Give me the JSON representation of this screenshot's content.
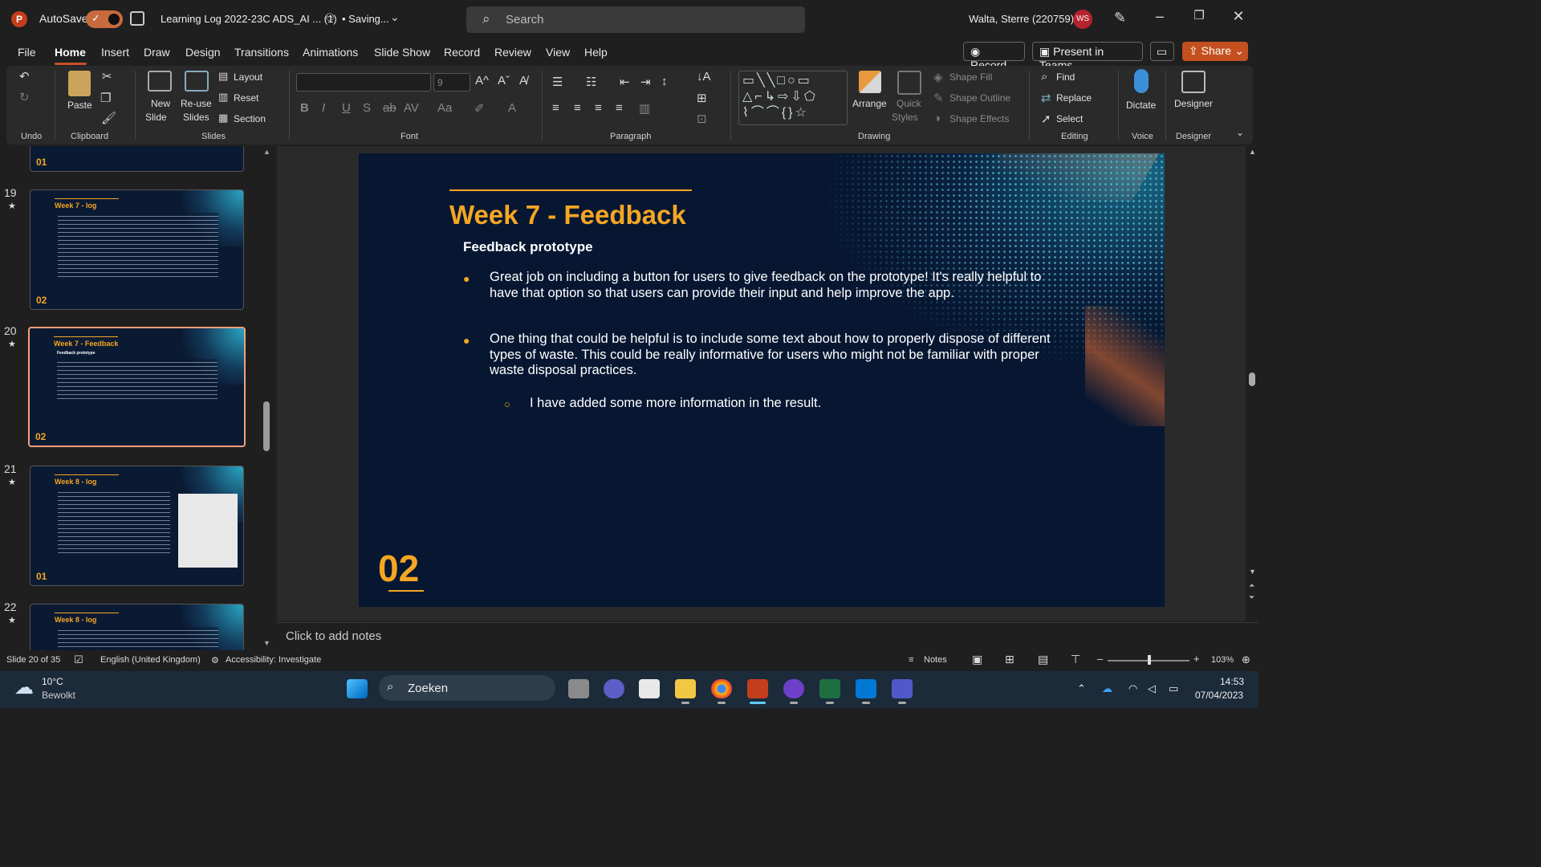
{
  "titlebar": {
    "app_icon": "P",
    "autosave_label": "AutoSave",
    "autosave_state": "on",
    "doc_title": "Learning Log 2022-23C ADS_AI ... (1)",
    "saving_status": "• Saving...",
    "search_placeholder": "Search",
    "user_name": "Walta, Sterre (220759)",
    "user_initials": "WS"
  },
  "menu": {
    "items": [
      "File",
      "Home",
      "Insert",
      "Draw",
      "Design",
      "Transitions",
      "Animations",
      "Slide Show",
      "Record",
      "Review",
      "View",
      "Help"
    ],
    "active": "Home",
    "record_label": "Record",
    "present_label": "Present in Teams",
    "share_label": "Share"
  },
  "ribbon": {
    "groups": {
      "undo": "Undo",
      "clipboard": "Clipboard",
      "slides": "Slides",
      "font": "Font",
      "paragraph": "Paragraph",
      "drawing": "Drawing",
      "editing": "Editing",
      "voice": "Voice",
      "designer": "Designer"
    },
    "paste": "Paste",
    "new_slide": [
      "New",
      "Slide"
    ],
    "reuse_slides": [
      "Re-use",
      "Slides"
    ],
    "layout": "Layout",
    "reset": "Reset",
    "section": "Section",
    "font_name": "",
    "font_size": "9",
    "arrange": "Arrange",
    "quick_styles": [
      "Quick",
      "Styles"
    ],
    "shape_fill": "Shape Fill",
    "shape_outline": "Shape Outline",
    "shape_effects": "Shape Effects",
    "find": "Find",
    "replace": "Replace",
    "select": "Select",
    "dictate": "Dictate",
    "designer": "Designer"
  },
  "thumbnails": [
    {
      "number": "",
      "title": "",
      "footer": "01",
      "partial": true
    },
    {
      "number": "19",
      "title": "Week 7 - log",
      "footer": "02"
    },
    {
      "number": "20",
      "title": "Week 7 - Feedback",
      "subtitle": "Feedback prototype",
      "footer": "02",
      "selected": true
    },
    {
      "number": "21",
      "title": "Week 8 - log",
      "footer": "01",
      "has_photo": true
    },
    {
      "number": "22",
      "title": "Week 8 - log",
      "footer": "",
      "partial": true
    }
  ],
  "slide": {
    "title": "Week 7 - Feedback",
    "subtitle": "Feedback prototype",
    "bullets": [
      "Great job on including a button for users to give feedback on the prototype! It's really helpful to have that option so that users can provide their input and help improve the app.",
      "One thing that could be helpful is to include some text about how to properly dispose of different types of waste. This could be really informative for users who might not be familiar with proper waste disposal practices."
    ],
    "sub_bullet": "I have added some more information in the result.",
    "slide_number_label": "02",
    "accent_color": "#f5a623",
    "background_color": "#071732"
  },
  "notes_placeholder": "Click to add notes",
  "status": {
    "slide_counter": "Slide 20 of 35",
    "language": "English (United Kingdom)",
    "accessibility": "Accessibility: Investigate",
    "notes": "Notes",
    "zoom": "103%"
  },
  "taskbar": {
    "weather_temp": "10°C",
    "weather_desc": "Bewolkt",
    "search_label": "Zoeken",
    "time": "14:53",
    "date": "07/04/2023"
  }
}
